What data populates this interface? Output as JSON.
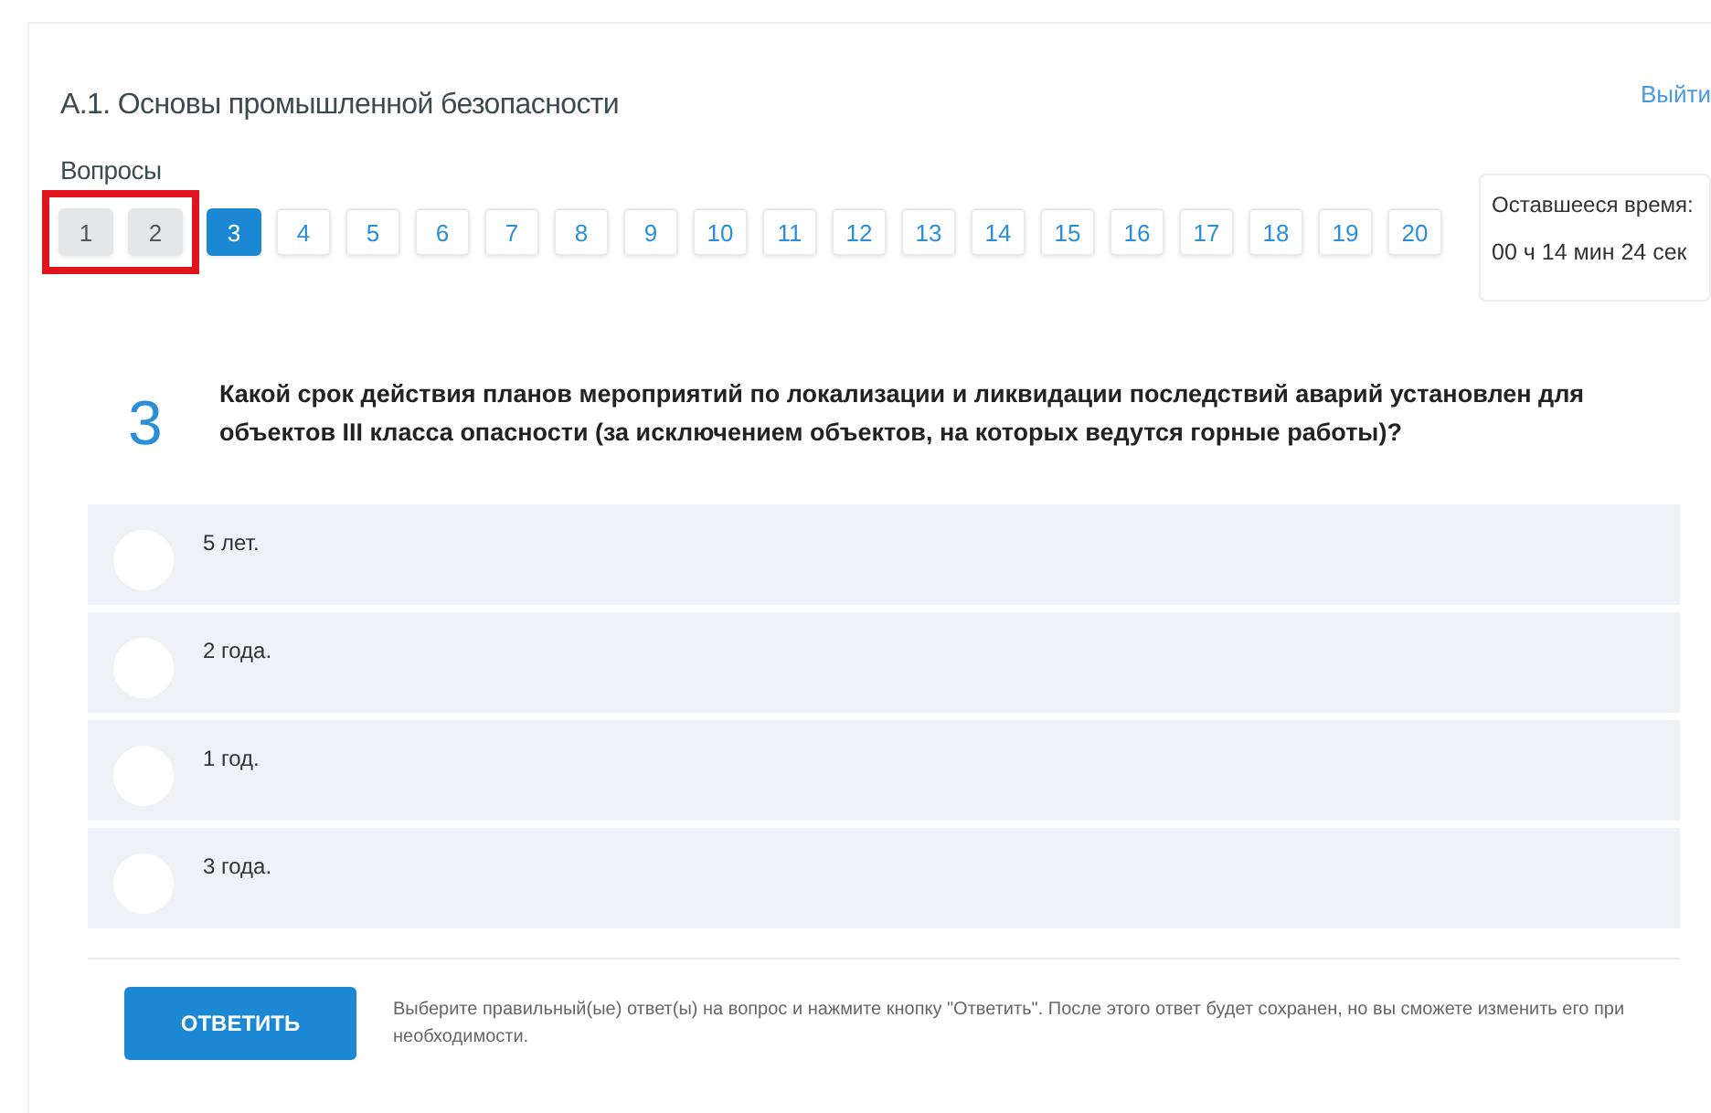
{
  "header": {
    "title": "А.1. Основы промышленной безопасности",
    "logout": "Выйти"
  },
  "questions_label": "Вопросы",
  "questions": [
    {
      "label": "1",
      "answered": true,
      "selected": false,
      "marked": true
    },
    {
      "label": "2",
      "answered": true,
      "selected": false,
      "marked": true
    },
    {
      "label": "3",
      "answered": false,
      "selected": true,
      "marked": false
    },
    {
      "label": "4",
      "answered": false,
      "selected": false,
      "marked": false
    },
    {
      "label": "5",
      "answered": false,
      "selected": false,
      "marked": false
    },
    {
      "label": "6",
      "answered": false,
      "selected": false,
      "marked": false
    },
    {
      "label": "7",
      "answered": false,
      "selected": false,
      "marked": false
    },
    {
      "label": "8",
      "answered": false,
      "selected": false,
      "marked": false
    },
    {
      "label": "9",
      "answered": false,
      "selected": false,
      "marked": false
    },
    {
      "label": "10",
      "answered": false,
      "selected": false,
      "marked": false
    },
    {
      "label": "11",
      "answered": false,
      "selected": false,
      "marked": false
    },
    {
      "label": "12",
      "answered": false,
      "selected": false,
      "marked": false
    },
    {
      "label": "13",
      "answered": false,
      "selected": false,
      "marked": false
    },
    {
      "label": "14",
      "answered": false,
      "selected": false,
      "marked": false
    },
    {
      "label": "15",
      "answered": false,
      "selected": false,
      "marked": false
    },
    {
      "label": "16",
      "answered": false,
      "selected": false,
      "marked": false
    },
    {
      "label": "17",
      "answered": false,
      "selected": false,
      "marked": false
    },
    {
      "label": "18",
      "answered": false,
      "selected": false,
      "marked": false
    },
    {
      "label": "19",
      "answered": false,
      "selected": false,
      "marked": false
    },
    {
      "label": "20",
      "answered": false,
      "selected": false,
      "marked": false
    }
  ],
  "timer": {
    "label": "Оставшееся время:",
    "value": "00 ч 14 мин 24 сек"
  },
  "question": {
    "number": "3",
    "text": "Какой срок действия планов мероприятий по локализации и ликвидации последствий аварий установлен для объектов III класса опасности (за исключением объектов, на которых ведутся горные работы)?"
  },
  "answers": [
    {
      "text": "5 лет.",
      "selected": false
    },
    {
      "text": "2 года.",
      "selected": false
    },
    {
      "text": "1 год.",
      "selected": false
    },
    {
      "text": "3 года.",
      "selected": false
    }
  ],
  "footer": {
    "button": "ОТВЕТИТЬ",
    "hint": "Выберите правильный(ые) ответ(ы) на вопрос и нажмите кнопку \"Ответить\". После этого ответ будет сохранен, но вы сможете изменить его при необходимости."
  }
}
